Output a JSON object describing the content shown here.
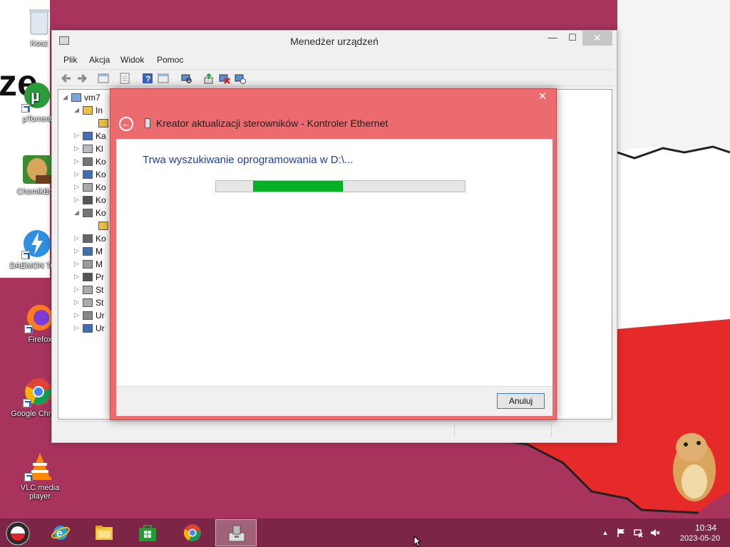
{
  "desktop": {
    "icons": [
      {
        "label": "Kosz",
        "icon": "recycle-bin-icon"
      },
      {
        "label": "µTorrent",
        "icon": "utorrent-icon"
      },
      {
        "label": "ChomikBox",
        "icon": "hamster-icon"
      },
      {
        "label": "DAEMON Tools",
        "icon": "daemon-tools-icon"
      },
      {
        "label": "Firefox",
        "icon": "firefox-icon"
      },
      {
        "label": "Google Chrome",
        "icon": "chrome-icon"
      },
      {
        "label": "VLC media player",
        "icon": "vlc-icon"
      }
    ]
  },
  "device_manager": {
    "title": "Menedżer urządzeń",
    "minimize": "—",
    "maximize": "☐",
    "close": "✕",
    "menu": [
      "Plik",
      "Akcja",
      "Widok",
      "Pomoc"
    ],
    "toolbar_icons": [
      "back-icon",
      "forward-icon",
      "properties-icon",
      "view-icon",
      "help-icon",
      "details-icon",
      "scan-icon",
      "update-driver-icon",
      "uninstall-icon",
      "disable-icon"
    ],
    "tree": {
      "root": "vm7",
      "items": [
        {
          "label": "In",
          "expanded": true
        },
        {
          "label": "",
          "expanded": false
        },
        {
          "label": "Ka",
          "expanded": false
        },
        {
          "label": "Kl",
          "expanded": false
        },
        {
          "label": "Ko",
          "expanded": false
        },
        {
          "label": "Ko",
          "expanded": false
        },
        {
          "label": "Ko",
          "expanded": false
        },
        {
          "label": "Ko",
          "expanded": false
        },
        {
          "label": "Ko",
          "expanded": true
        },
        {
          "label": "",
          "expanded": false
        },
        {
          "label": "Ko",
          "expanded": false
        },
        {
          "label": "M",
          "expanded": false
        },
        {
          "label": "M",
          "expanded": false
        },
        {
          "label": "Pr",
          "expanded": false
        },
        {
          "label": "St",
          "expanded": false
        },
        {
          "label": "St",
          "expanded": false
        },
        {
          "label": "Ur",
          "expanded": false
        },
        {
          "label": "Ur",
          "expanded": false
        }
      ]
    }
  },
  "wizard": {
    "close": "✕",
    "back": "←",
    "title": "Kreator aktualizacji sterowników - Kontroler Ethernet",
    "message": "Trwa wyszukiwanie oprogramowania w D:\\...",
    "progress": {
      "segment_start": 0.15,
      "segment_end": 0.51
    },
    "cancel_label": "Anuluj"
  },
  "taskbar": {
    "buttons": [
      {
        "name": "start-button",
        "icon": "start-icon"
      },
      {
        "name": "internet-explorer",
        "icon": "ie-icon"
      },
      {
        "name": "file-explorer",
        "icon": "folder-icon"
      },
      {
        "name": "store",
        "icon": "store-icon"
      },
      {
        "name": "chrome",
        "icon": "chrome-icon"
      },
      {
        "name": "device-manager",
        "icon": "device-manager-icon",
        "active": true
      }
    ],
    "tray": {
      "show_hidden": "▲",
      "time": "10:34",
      "date": "2023-05-20"
    }
  },
  "colors": {
    "wallpaper": "#a8345e",
    "wizard_frame": "#eb6b6e",
    "progress_fill": "#06b025",
    "link_text": "#1f3f9a"
  }
}
